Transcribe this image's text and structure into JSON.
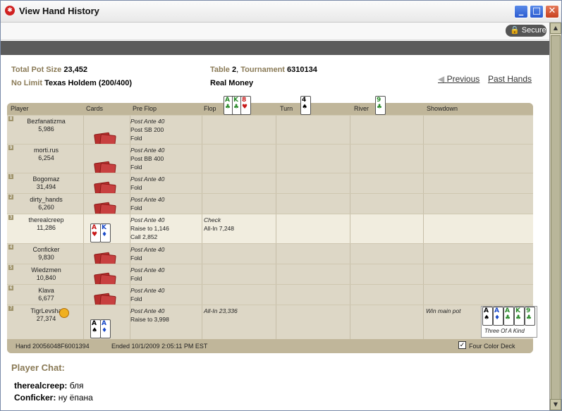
{
  "window": {
    "title": "View Hand History",
    "secure_label": "Secure"
  },
  "info": {
    "total_pot_label": "Total Pot Size",
    "total_pot_value": "23,452",
    "game_label": "No Limit",
    "game_value": "Texas Holdem",
    "blinds": "(200/400)",
    "table_label": "Table",
    "table_value": "2",
    "tournament_label": "Tournament",
    "tournament_value": "6310134",
    "money": "Real Money"
  },
  "nav": {
    "previous": "Previous",
    "past": "Past Hands"
  },
  "headers": {
    "player": "Player",
    "cards": "Cards",
    "preflop": "Pre Flop",
    "flop": "Flop",
    "turn": "Turn",
    "river": "River",
    "showdown": "Showdown"
  },
  "board": {
    "flop": [
      {
        "rank": "A",
        "suit": "♣",
        "color": "#2a8a2a"
      },
      {
        "rank": "K",
        "suit": "♣",
        "color": "#2a8a2a"
      },
      {
        "rank": "8",
        "suit": "♥",
        "color": "#c81818"
      }
    ],
    "turn": [
      {
        "rank": "4",
        "suit": "♠",
        "color": "#000"
      }
    ],
    "river": [
      {
        "rank": "9",
        "suit": "♣",
        "color": "#2a8a2a"
      }
    ]
  },
  "players": [
    {
      "seat": "8",
      "name": "Bezfanatizma",
      "chips": "5,986",
      "preflop": [
        "Post Ante 40",
        "Post SB 200",
        "Fold"
      ],
      "flop": [],
      "showdown": ""
    },
    {
      "seat": "9",
      "name": "morti.rus",
      "chips": "6,254",
      "preflop": [
        "Post Ante 40",
        "Post BB 400",
        "Fold"
      ],
      "flop": [],
      "showdown": ""
    },
    {
      "seat": "1",
      "name": "Bogomaz",
      "chips": "31,494",
      "preflop": [
        "Post Ante 40",
        "Fold"
      ],
      "flop": [],
      "showdown": ""
    },
    {
      "seat": "2",
      "name": "dirty_hands",
      "chips": "6,260",
      "preflop": [
        "Post Ante 40",
        "Fold"
      ],
      "flop": [],
      "showdown": ""
    },
    {
      "seat": "3",
      "name": "therealcreep",
      "chips": "11,286",
      "preflop": [
        "Post Ante 40",
        "Raise to 1,146",
        "Call 2,852"
      ],
      "flop": [
        "Check",
        "All-In 7,248"
      ],
      "showdown": ""
    },
    {
      "seat": "4",
      "name": "Conficker",
      "chips": "9,830",
      "preflop": [
        "Post Ante 40",
        "Fold"
      ],
      "flop": [],
      "showdown": ""
    },
    {
      "seat": "5",
      "name": "Wiedzmen",
      "chips": "10,840",
      "preflop": [
        "Post Ante 40",
        "Fold"
      ],
      "flop": [],
      "showdown": ""
    },
    {
      "seat": "6",
      "name": "Klava",
      "chips": "6,677",
      "preflop": [
        "Post Ante 40",
        "Fold"
      ],
      "flop": [],
      "showdown": ""
    },
    {
      "seat": "7",
      "name": "TigrLevsha",
      "chips": "27,374",
      "preflop": [
        "Post Ante 40",
        "Raise to 3,998"
      ],
      "flop": [
        "All-In 23,336"
      ],
      "showdown": "Win main pot"
    }
  ],
  "hole_cards": {
    "therealcreep": [
      {
        "rank": "A",
        "suit": "♥",
        "color": "#c81818"
      },
      {
        "rank": "K",
        "suit": "♦",
        "color": "#1a4ac8"
      }
    ],
    "TigrLevsha": [
      {
        "rank": "A",
        "suit": "♠",
        "color": "#000"
      },
      {
        "rank": "A",
        "suit": "♦",
        "color": "#1a4ac8"
      }
    ]
  },
  "showdown_hand": {
    "cards": [
      {
        "rank": "A",
        "suit": "♠",
        "color": "#000"
      },
      {
        "rank": "A",
        "suit": "♦",
        "color": "#1a4ac8"
      },
      {
        "rank": "A",
        "suit": "♣",
        "color": "#2a8a2a"
      },
      {
        "rank": "K",
        "suit": "♣",
        "color": "#2a8a2a"
      },
      {
        "rank": "9",
        "suit": "♣",
        "color": "#2a8a2a"
      }
    ],
    "label": "Three Of A Kind"
  },
  "footer": {
    "hand": "Hand 20056048F6001394",
    "ended": "Ended 10/1/2009 2:05:11 PM EST",
    "four_color": "Four Color Deck",
    "four_color_checked": true
  },
  "chat": {
    "title": "Player Chat:",
    "messages": [
      {
        "user": "therealcreep:",
        "text": "бля"
      },
      {
        "user": "Conficker:",
        "text": "ну ёпана"
      }
    ]
  }
}
